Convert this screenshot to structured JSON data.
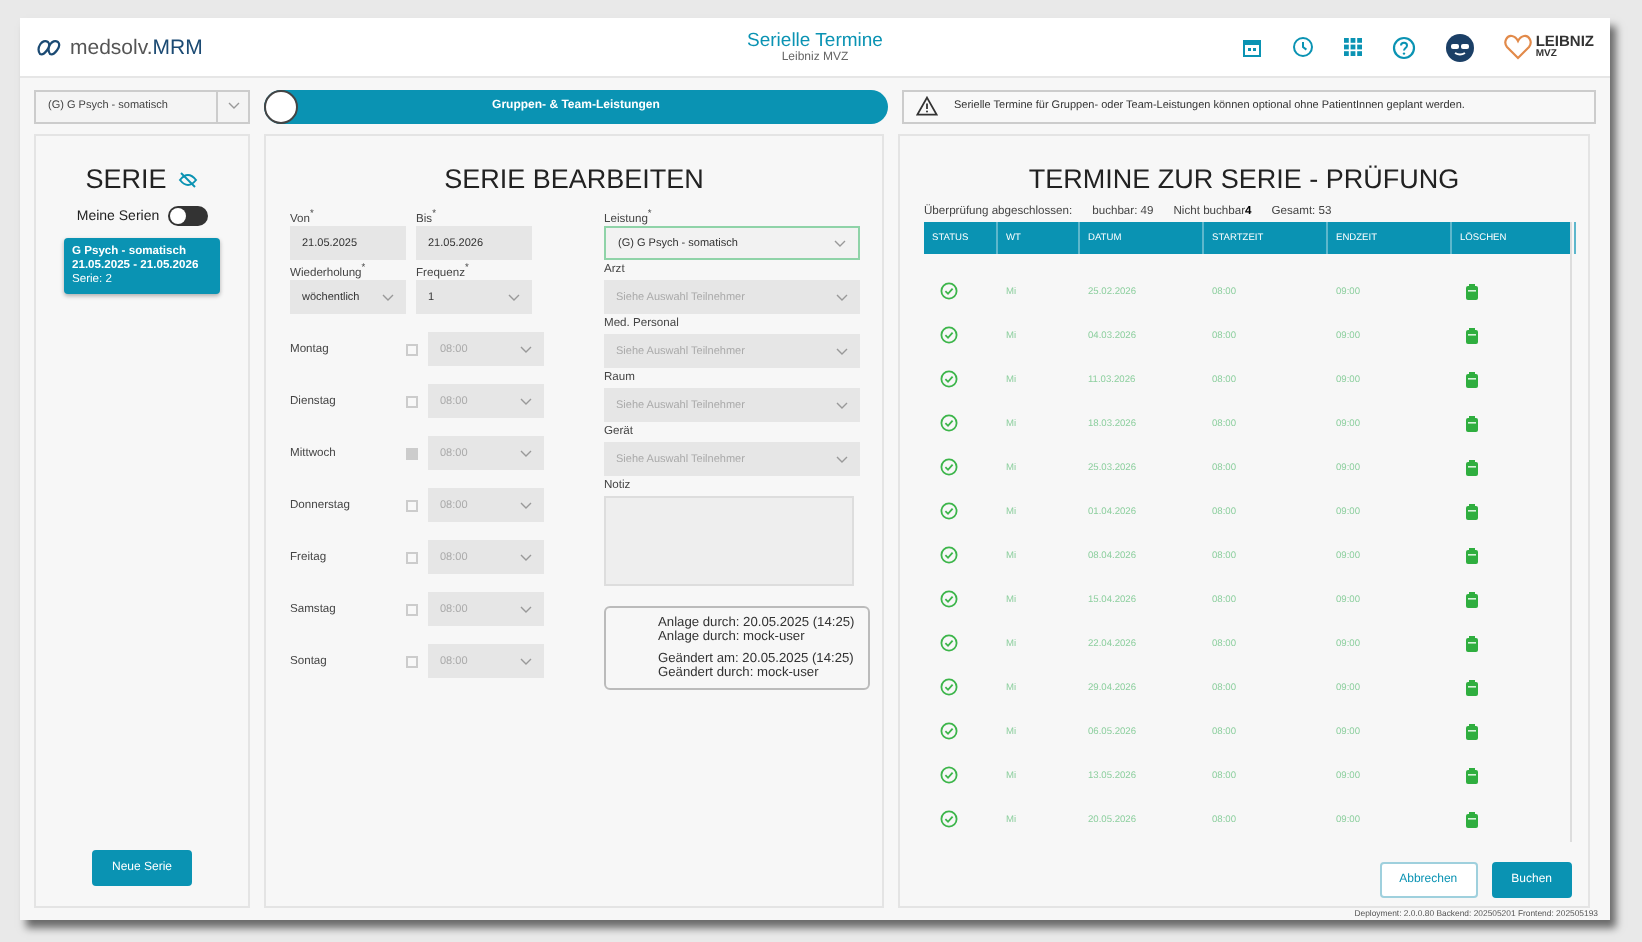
{
  "header": {
    "brand": "medsolv.",
    "brand_bold": "MRM",
    "title": "Serielle Termine",
    "subtitle": "Leibniz MVZ",
    "org_name": "LEIBNIZ",
    "org_sub": "MVZ"
  },
  "filter_select": {
    "value": "(G) G Psych - somatisch"
  },
  "mode_toggle": {
    "label": "Gruppen- & Team-Leistungen",
    "on": false
  },
  "info_banner": {
    "text": "Serielle Termine für Gruppen- oder Team-Leistungen können optional ohne PatientInnen geplant werden."
  },
  "sidebar": {
    "title": "SERIE",
    "my_series": {
      "label": "Meine Serien",
      "on": false
    },
    "items": [
      {
        "title": "G Psych - somatisch",
        "dates": "21.05.2025 - 21.05.2026",
        "number": "Serie: 2",
        "selected": true
      }
    ],
    "new_button": "Neue Serie"
  },
  "edit": {
    "title": "SERIE BEARBEITEN",
    "top_fields": [
      {
        "label": "Von",
        "mark": "*",
        "value": "21.05.2025",
        "kind": "input"
      },
      {
        "label": "Bis",
        "mark": "*",
        "value": "21.05.2026",
        "kind": "input"
      },
      {
        "label": "Wiederholung",
        "mark": "*",
        "value": "wöchentlich",
        "kind": "select"
      },
      {
        "label": "Frequenz",
        "mark": "*",
        "value": "1",
        "kind": "select"
      }
    ],
    "days": [
      {
        "label": "Montag",
        "checked": false,
        "time": "08:00"
      },
      {
        "label": "Dienstag",
        "checked": false,
        "time": "08:00"
      },
      {
        "label": "Mittwoch",
        "checked": true,
        "time": "08:00"
      },
      {
        "label": "Donnerstag",
        "checked": false,
        "time": "08:00"
      },
      {
        "label": "Freitag",
        "checked": false,
        "time": "08:00"
      },
      {
        "label": "Samstag",
        "checked": false,
        "time": "08:00"
      },
      {
        "label": "Sontag",
        "checked": false,
        "time": "08:00"
      }
    ],
    "leistung": {
      "label": "Leistung",
      "mark": "*",
      "value": "(G) G Psych - somatisch"
    },
    "participants": [
      {
        "label": "Arzt",
        "placeholder": "Siehe Auswahl Teilnehmer"
      },
      {
        "label": "Med. Personal",
        "placeholder": "Siehe Auswahl Teilnehmer"
      },
      {
        "label": "Raum",
        "placeholder": "Siehe Auswahl Teilnehmer"
      },
      {
        "label": "Gerät",
        "placeholder": "Siehe Auswahl Teilnehmer"
      }
    ],
    "notiz": {
      "label": "Notiz"
    },
    "audit": [
      "Anlage durch: 20.05.2025 (14:25)",
      "Anlage durch: mock-user",
      "Geändert am: 20.05.2025 (14:25)",
      "Geändert durch: mock-user"
    ]
  },
  "results": {
    "title": "TERMINE ZUR SERIE - PRÜFUNG",
    "summary": [
      "Überprüfung abgeschlossen:",
      "buchbar: 49",
      "Nicht buchbar**4**",
      "Gesamt: 53"
    ],
    "columns": [
      "STATUS",
      "WT",
      "DATUM",
      "STARTZEIT",
      "ENDZEIT",
      "LÖSCHEN"
    ],
    "rows": [
      {
        "kind": "ok",
        "wt": "Mi",
        "datum": "25.02.2026",
        "start": "08:00",
        "end": "09:00"
      },
      {
        "kind": "ok",
        "wt": "Mi",
        "datum": "04.03.2026",
        "start": "08:00",
        "end": "09:00"
      },
      {
        "kind": "ok",
        "wt": "Mi",
        "datum": "11.03.2026",
        "start": "08:00",
        "end": "09:00"
      },
      {
        "kind": "ok",
        "wt": "Mi",
        "datum": "18.03.2026",
        "start": "08:00",
        "end": "09:00"
      },
      {
        "kind": "ok",
        "wt": "Mi",
        "datum": "25.03.2026",
        "start": "08:00",
        "end": "09:00"
      },
      {
        "kind": "ok",
        "wt": "Mi",
        "datum": "01.04.2026",
        "start": "08:00",
        "end": "09:00"
      },
      {
        "kind": "ok",
        "wt": "Mi",
        "datum": "08.04.2026",
        "start": "08:00",
        "end": "09:00"
      },
      {
        "kind": "ok",
        "wt": "Mi",
        "datum": "15.04.2026",
        "start": "08:00",
        "end": "09:00"
      },
      {
        "kind": "ok",
        "wt": "Mi",
        "datum": "22.04.2026",
        "start": "08:00",
        "end": "09:00"
      },
      {
        "kind": "ok",
        "wt": "Mi",
        "datum": "29.04.2026",
        "start": "08:00",
        "end": "09:00"
      },
      {
        "kind": "ok",
        "wt": "Mi",
        "datum": "06.05.2026",
        "start": "08:00",
        "end": "09:00"
      },
      {
        "kind": "ok",
        "wt": "Mi",
        "datum": "13.05.2026",
        "start": "08:00",
        "end": "09:00"
      },
      {
        "kind": "ok",
        "wt": "Mi",
        "datum": "20.05.2026",
        "start": "08:00",
        "end": "09:00"
      }
    ],
    "buttons": [
      {
        "label": "Abbrechen",
        "kind": "secondary"
      },
      {
        "label": "Buchen",
        "kind": "primary"
      }
    ]
  },
  "footer": "Deployment: 2.0.0.80  Backend: 202505201  Frontend: 202505193"
}
